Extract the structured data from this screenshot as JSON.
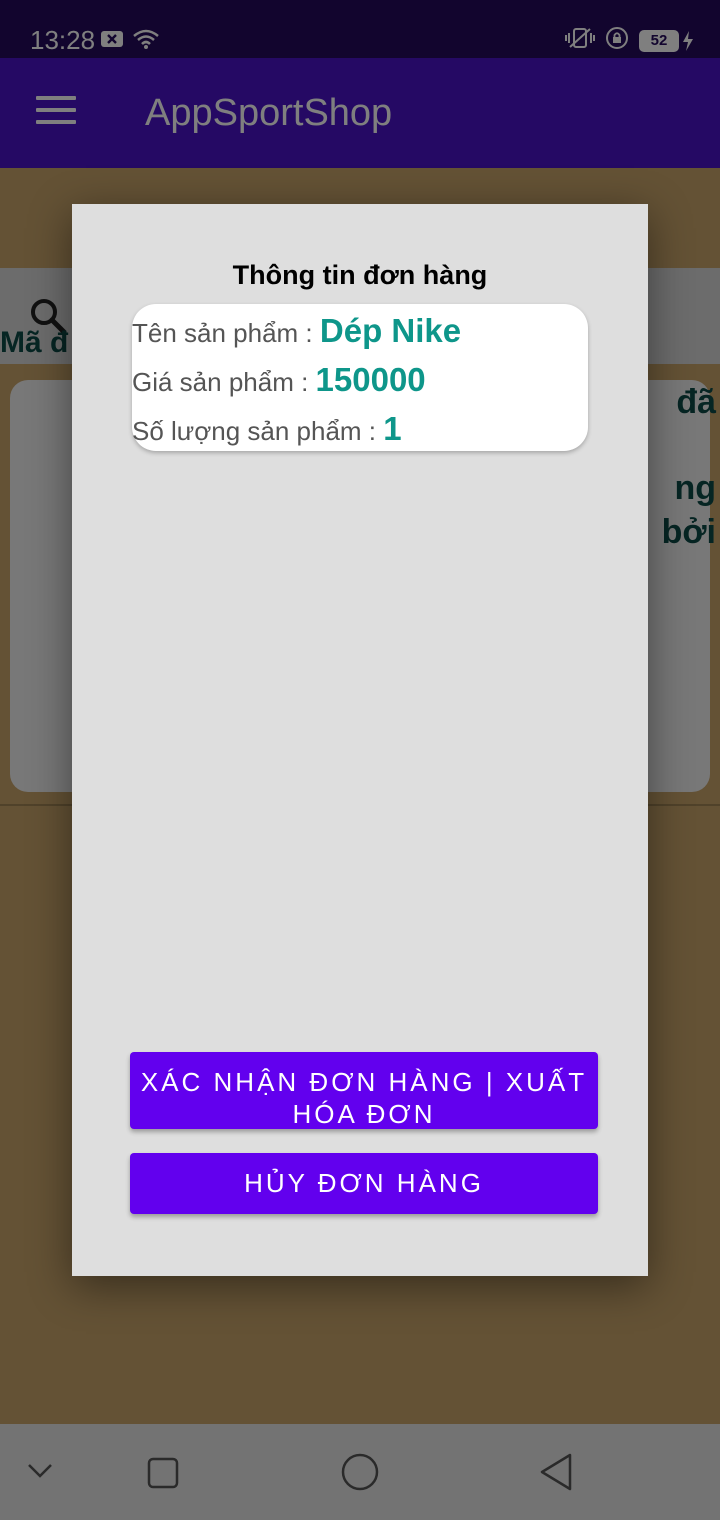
{
  "status_bar": {
    "time": "13:28",
    "battery_level": "52",
    "icons": [
      "notification-x-icon",
      "wifi-icon",
      "vibrate-icon",
      "rotation-lock-icon",
      "battery-icon",
      "charging-icon"
    ]
  },
  "app_bar": {
    "title": "AppSportShop",
    "menu_icon": "hamburger-menu-icon"
  },
  "background_page": {
    "card_label_partial": "Mã đ",
    "card_right_partial": [
      "đã",
      "ng",
      "bởi"
    ]
  },
  "dialog": {
    "title": "Thông tin đơn hàng",
    "product_name_label": "Tên sản phẩm : ",
    "product_name": "Dép Nike",
    "price_label": "Giá sản phẩm : ",
    "price": "150000",
    "quantity_label": "Số lượng sản phẩm : ",
    "quantity": "1",
    "confirm_button": "XÁC NHẬN ĐƠN HÀNG | XUẤT HÓA ĐƠN",
    "cancel_button": "HỦY ĐƠN HÀNG"
  },
  "colors": {
    "app_bar": "#4a13c9",
    "button": "#6200ee",
    "value_text": "#0e968a"
  }
}
